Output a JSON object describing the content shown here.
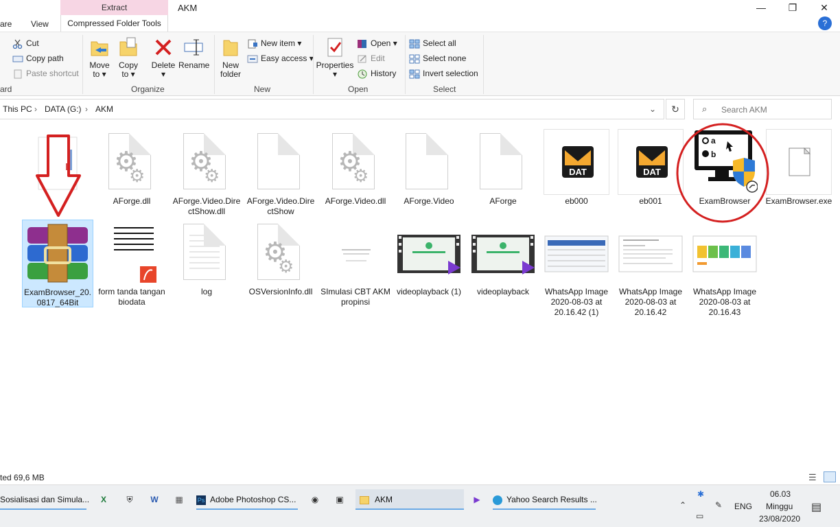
{
  "window": {
    "title": "AKM",
    "contextual_tab_header": "Extract",
    "contextual_tab": "Compressed Folder Tools",
    "tabs": [
      "are",
      "View"
    ],
    "buttons": {
      "minimize": "—",
      "maximize": "❐",
      "close": "✕",
      "help": "?"
    }
  },
  "ribbon": {
    "clipboard": {
      "cut": "Cut",
      "copy_path": "Copy path",
      "paste_shortcut": "Paste shortcut",
      "label": "ard"
    },
    "organize": {
      "move_to": "Move to ▾",
      "copy_to": "Copy to ▾",
      "delete": "Delete ▾",
      "rename": "Rename",
      "label": "Organize"
    },
    "new": {
      "new_folder": "New folder",
      "new_item": "New item ▾",
      "easy_access": "Easy access ▾",
      "label": "New"
    },
    "open": {
      "properties": "Properties ▾",
      "open": "Open ▾",
      "edit": "Edit",
      "history": "History",
      "label": "Open"
    },
    "select": {
      "select_all": "Select all",
      "select_none": "Select none",
      "invert": "Invert selection",
      "label": "Select"
    }
  },
  "address": {
    "crumbs": [
      "This PC",
      "DATA (G:)",
      "AKM"
    ],
    "search_placeholder": "Search AKM"
  },
  "files_row1": [
    {
      "name": "",
      "kind": "partial"
    },
    {
      "name": "AForge.dll",
      "kind": "dll"
    },
    {
      "name": "AForge.Video.DirectShow.dll",
      "kind": "dll"
    },
    {
      "name": "AForge.Video.DirectShow",
      "kind": "blank"
    },
    {
      "name": "AForge.Video.dll",
      "kind": "dll"
    },
    {
      "name": "AForge.Video",
      "kind": "blank"
    },
    {
      "name": "AForge",
      "kind": "blank"
    },
    {
      "name": "eb000",
      "kind": "dat"
    },
    {
      "name": "eb001",
      "kind": "dat"
    },
    {
      "name": "ExamBrowser",
      "kind": "exam"
    },
    {
      "name": "ExamBrowser.exe",
      "kind": "blank"
    }
  ],
  "files_row2": [
    {
      "name": "ExamBrowser_20.0817_64Bit",
      "kind": "rar"
    },
    {
      "name": "form tanda tangan biodata",
      "kind": "pdfdoc"
    },
    {
      "name": "log",
      "kind": "text"
    },
    {
      "name": "OSVersionInfo.dll",
      "kind": "dll"
    },
    {
      "name": "SImulasi CBT AKM propinsi",
      "kind": "smalldoc"
    },
    {
      "name": "videoplayback (1)",
      "kind": "video"
    },
    {
      "name": "videoplayback",
      "kind": "video"
    },
    {
      "name": "WhatsApp Image 2020-08-03 at 20.16.42 (1)",
      "kind": "img1"
    },
    {
      "name": "WhatsApp Image 2020-08-03 at 20.16.42",
      "kind": "img2"
    },
    {
      "name": "WhatsApp Image 2020-08-03 at 20.16.43",
      "kind": "img3"
    }
  ],
  "dat_label": "DAT",
  "status": {
    "text": "ted  69,6 MB"
  },
  "taskbar": {
    "items": [
      "Sosialisasi dan Simula...",
      "Adobe Photoshop CS...",
      "AKM",
      "Yahoo Search Results ..."
    ],
    "lang": "ENG",
    "time": "06.03",
    "day": "Minggu",
    "date": "23/08/2020"
  },
  "colors": {
    "accent_red": "#d42020",
    "selection": "#cce8ff",
    "ribbon_bg": "#f7f7f7",
    "extract_band": "#f7d6e4"
  }
}
